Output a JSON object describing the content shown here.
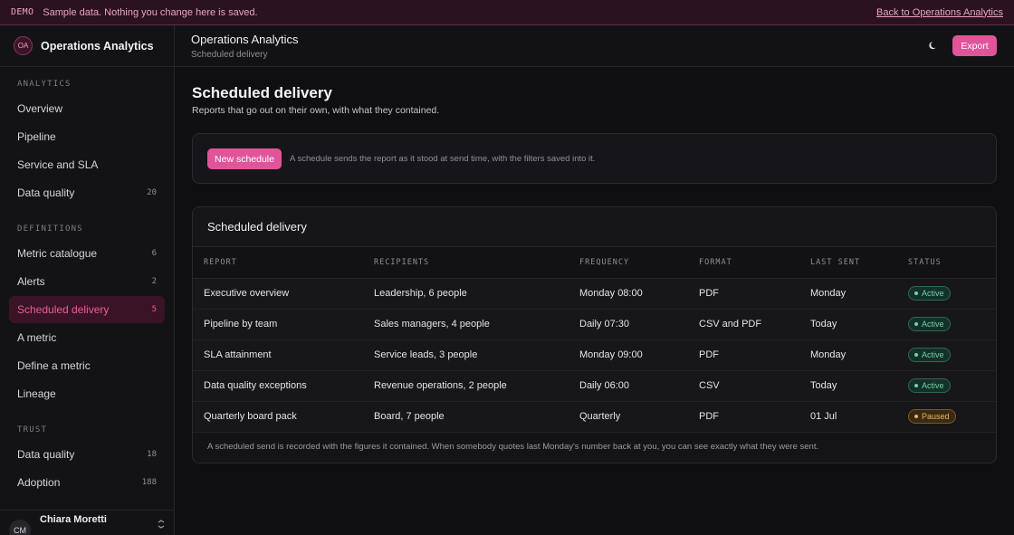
{
  "banner": {
    "tag": "DEMO",
    "message": "Sample data. Nothing you change here is saved.",
    "back_link": "Back to Operations Analytics"
  },
  "sidebar": {
    "brand": {
      "initials": "OA",
      "name": "Operations Analytics"
    },
    "sections": [
      {
        "title": "ANALYTICS",
        "items": [
          {
            "label": "Overview",
            "count": ""
          },
          {
            "label": "Pipeline",
            "count": ""
          },
          {
            "label": "Service and SLA",
            "count": ""
          },
          {
            "label": "Data quality",
            "count": "20"
          }
        ]
      },
      {
        "title": "DEFINITIONS",
        "items": [
          {
            "label": "Metric catalogue",
            "count": "6"
          },
          {
            "label": "Alerts",
            "count": "2"
          },
          {
            "label": "Scheduled delivery",
            "count": "5"
          },
          {
            "label": "A metric",
            "count": ""
          },
          {
            "label": "Define a metric",
            "count": ""
          },
          {
            "label": "Lineage",
            "count": ""
          }
        ]
      },
      {
        "title": "TRUST",
        "items": [
          {
            "label": "Data quality",
            "count": "18"
          },
          {
            "label": "Adoption",
            "count": "188"
          }
        ]
      }
    ],
    "user": {
      "initials": "CM",
      "name": "Chiara Moretti"
    }
  },
  "header": {
    "title": "Operations Analytics",
    "breadcrumb": "Scheduled delivery",
    "export_label": "Export",
    "theme_icon": "moon-icon"
  },
  "main": {
    "title": "Scheduled delivery",
    "subtitle": "Reports that go out on their own, with what they contained.",
    "new_schedule_label": "New schedule",
    "hint": "A schedule sends the report as it stood at send time, with the filters saved into it.",
    "table": {
      "title": "Scheduled delivery",
      "columns": [
        "REPORT",
        "RECIPIENTS",
        "FREQUENCY",
        "FORMAT",
        "LAST SENT",
        "STATUS"
      ],
      "rows": [
        {
          "report": "Executive overview",
          "recipients": "Leadership, 6 people",
          "frequency": "Monday 08:00",
          "format": "PDF",
          "last_sent": "Monday",
          "status": "Active"
        },
        {
          "report": "Pipeline by team",
          "recipients": "Sales managers, 4 people",
          "frequency": "Daily 07:30",
          "format": "CSV and PDF",
          "last_sent": "Today",
          "status": "Active"
        },
        {
          "report": "SLA attainment",
          "recipients": "Service leads, 3 people",
          "frequency": "Monday 09:00",
          "format": "PDF",
          "last_sent": "Monday",
          "status": "Active"
        },
        {
          "report": "Data quality exceptions",
          "recipients": "Revenue operations, 2 people",
          "frequency": "Daily 06:00",
          "format": "CSV",
          "last_sent": "Today",
          "status": "Active"
        },
        {
          "report": "Quarterly board pack",
          "recipients": "Board, 7 people",
          "frequency": "Quarterly",
          "format": "PDF",
          "last_sent": "01 Jul",
          "status": "Paused"
        }
      ],
      "footnote": "A scheduled send is recorded with the figures it contained. When somebody quotes last Monday's number back at you, you can see exactly what they were sent."
    }
  },
  "colors": {
    "accent": "#e0559a",
    "active_nav_bg": "#3a1426",
    "status_active": "#6fd3a6",
    "status_paused": "#e9b661"
  }
}
